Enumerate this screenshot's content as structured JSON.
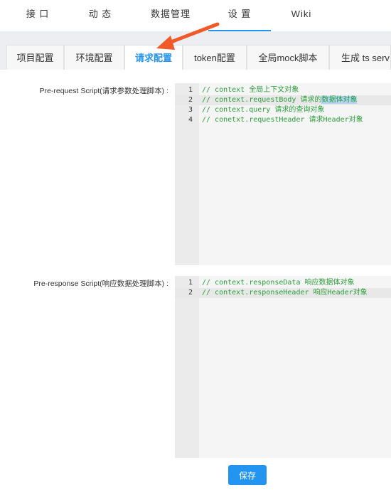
{
  "topnav": {
    "items": [
      "接 口",
      "动 态",
      "数据管理",
      "设 置",
      "Wiki"
    ],
    "active_index": 3
  },
  "subtabs": {
    "items": [
      "项目配置",
      "环境配置",
      "请求配置",
      "token配置",
      "全局mock脚本",
      "生成 ts serv"
    ],
    "active_index": 2
  },
  "pre_request": {
    "label": "Pre-request Script(请求参数处理脚本) :",
    "lines": [
      {
        "num": "1",
        "code": "// context 全局上下文对象"
      },
      {
        "num": "2",
        "code_before": "// context.requestBody 请求的",
        "code_selected": "数据体对象",
        "highlighted": true
      },
      {
        "num": "3",
        "code": "// context.query 请求的查询对象"
      },
      {
        "num": "4",
        "code": "// conetxt.requestHeader 请求Header对象"
      }
    ]
  },
  "pre_response": {
    "label": "Pre-response Script(响应数据处理脚本) :",
    "lines": [
      {
        "num": "1",
        "code": "// context.responseData 响应数据体对象"
      },
      {
        "num": "2",
        "code": "// context.responseHeader 响应Header对象",
        "highlighted": true
      }
    ]
  },
  "save_button": "保存",
  "colors": {
    "accent": "#2395f1",
    "arrow": "#f05a28",
    "code_comment": "#2a9d3a",
    "page_gray": "#eceef1"
  }
}
